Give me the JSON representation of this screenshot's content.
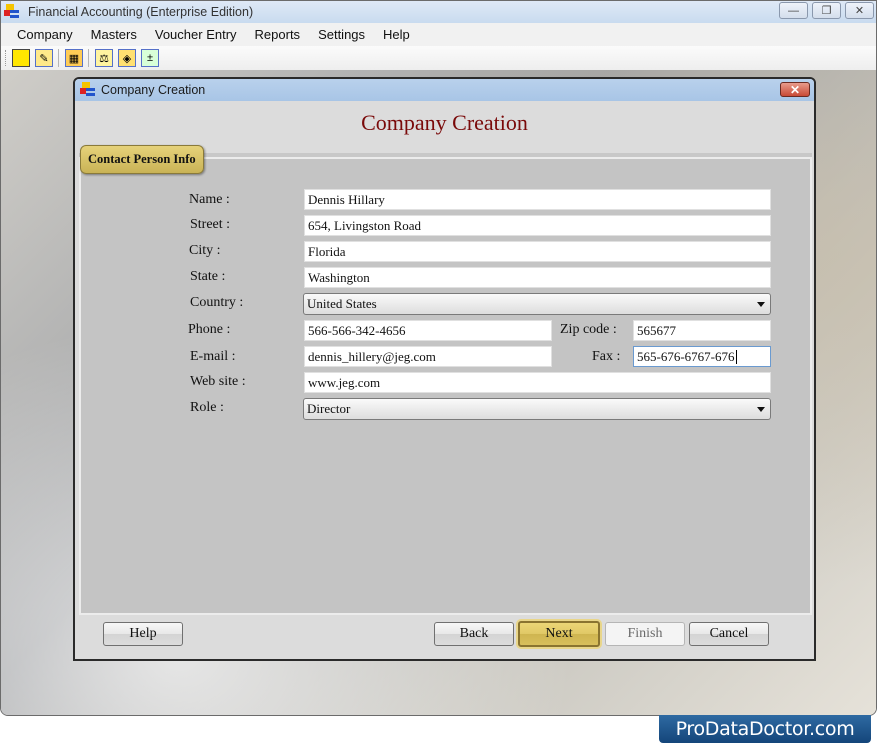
{
  "app": {
    "title": "Financial Accounting (Enterprise Edition)",
    "window_controls": {
      "minimize": "—",
      "restore": "❐",
      "close": "✕"
    }
  },
  "menubar": {
    "items": [
      "Company",
      "Masters",
      "Voucher Entry",
      "Reports",
      "Settings",
      "Help"
    ]
  },
  "toolbar": {
    "icons": [
      "new-company-icon",
      "open-company-icon",
      "grid-icon",
      "balance-scale-icon",
      "ledger-icon",
      "add-remove-icon"
    ]
  },
  "dialog": {
    "title": "Company Creation",
    "close_glyph": "✕",
    "heading": "Company Creation",
    "tab_label": "Contact Person Info",
    "fields": {
      "name": {
        "label": "Name :",
        "value": "Dennis Hillary"
      },
      "street": {
        "label": "Street :",
        "value": "654, Livingston Road"
      },
      "city": {
        "label": "City :",
        "value": "Florida"
      },
      "state": {
        "label": "State :",
        "value": "Washington"
      },
      "country": {
        "label": "Country :",
        "value": "United States"
      },
      "phone": {
        "label": "Phone :",
        "value": "566-566-342-4656"
      },
      "zip": {
        "label": "Zip code :",
        "value": "565677"
      },
      "email": {
        "label": "E-mail :",
        "value": "dennis_hillery@jeg.com"
      },
      "fax": {
        "label": "Fax :",
        "value": "565-676-6767-676"
      },
      "website": {
        "label": "Web site :",
        "value": "www.jeg.com"
      },
      "role": {
        "label": "Role :",
        "value": "Director"
      }
    },
    "buttons": {
      "help": "Help",
      "back": "Back",
      "next": "Next",
      "finish": "Finish",
      "cancel": "Cancel"
    }
  },
  "brand": {
    "text": "ProDataDoctor.com"
  }
}
